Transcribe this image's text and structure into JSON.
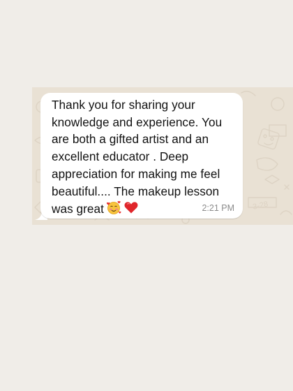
{
  "chat": {
    "message": {
      "text": "Thank you for sharing your knowledge and experience. You are both a gifted artist and an excellent educator . Deep appreciation for making me feel beautiful.... The makeup lesson was great",
      "emojis": [
        "smiling-face-with-hearts-icon",
        "red-heart-icon"
      ],
      "time": "2:21 PM"
    }
  },
  "colors": {
    "page_background": "#f0ede8",
    "chat_wallpaper": "#e9e1d4",
    "bubble": "#ffffff",
    "text": "#111111",
    "timestamp": "#8b8b8b"
  }
}
